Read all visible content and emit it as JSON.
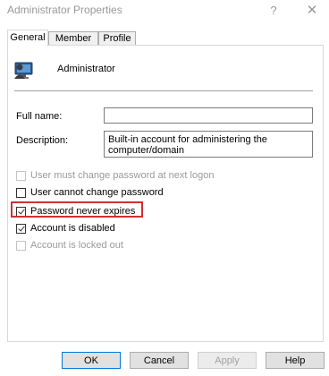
{
  "window": {
    "title": "Administrator Properties",
    "help_glyph": "?",
    "close_glyph": "✕"
  },
  "tabs": [
    {
      "label": "General",
      "active": true
    },
    {
      "label": "Member Of",
      "active": false
    },
    {
      "label": "Profile",
      "active": false
    }
  ],
  "account": {
    "name": "Administrator",
    "icon": "user-computer-icon"
  },
  "fields": {
    "full_name_label": "Full name:",
    "full_name_value": "",
    "description_label": "Description:",
    "description_value": "Built-in account for administering the computer/domain"
  },
  "options": [
    {
      "label": "User must change password at next logon",
      "checked": false,
      "enabled": false
    },
    {
      "label": "User cannot change password",
      "checked": false,
      "enabled": true
    },
    {
      "label": "Password never expires",
      "checked": true,
      "enabled": true,
      "highlighted": true
    },
    {
      "label": "Account is disabled",
      "checked": true,
      "enabled": true
    },
    {
      "label": "Account is locked out",
      "checked": false,
      "enabled": false
    }
  ],
  "buttons": {
    "ok": "OK",
    "cancel": "Cancel",
    "apply": "Apply",
    "help": "Help"
  },
  "colors": {
    "highlight": "#d32f2f",
    "default_button_border": "#0078d7"
  }
}
